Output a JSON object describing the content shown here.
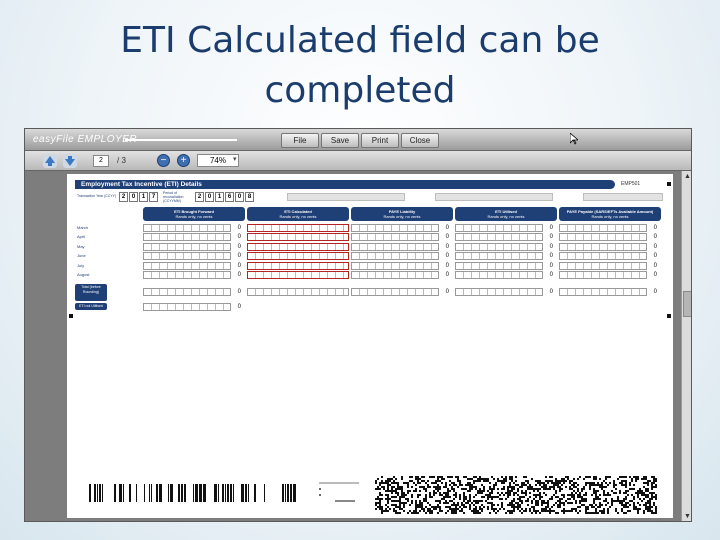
{
  "slide": {
    "title_line1": "ETI Calculated field can be",
    "title_line2": "completed"
  },
  "app": {
    "title": "easyFile EMPLOYER",
    "colors": {
      "accent": "#1f3f77",
      "highlight": "#b52222"
    }
  },
  "menu": [
    {
      "id": "file",
      "label": "File"
    },
    {
      "id": "save",
      "label": "Save"
    },
    {
      "id": "print",
      "label": "Print"
    },
    {
      "id": "close",
      "label": "Close"
    }
  ],
  "toolbar": {
    "page_current": "2",
    "page_sep": "/ 3",
    "zoom_level": "74%",
    "icons": [
      "arrow-up-icon",
      "arrow-down-icon",
      "zoom-out-icon",
      "zoom-in-icon"
    ]
  },
  "form": {
    "title": "Employment Tax Incentive (ETI) Details",
    "code": "EMP501",
    "transaction_year_label": "Transaction Year (CCYY)",
    "transaction_year_digits": [
      "2",
      "0",
      "1",
      "7"
    ],
    "reconciliation_label": "Period of reconciliation (CCYYMM)",
    "reconciliation_digits": [
      "2",
      "0",
      "1",
      "6",
      "0",
      "8"
    ],
    "columns": [
      {
        "title": "ETI Brought Forward",
        "sub": "Rands only, no cents"
      },
      {
        "title": "ETI Calculated",
        "sub": "Rands only, no cents"
      },
      {
        "title": "PAYE Liability",
        "sub": "Rands only, no cents"
      },
      {
        "title": "ETI Utilised",
        "sub": "Rands only, no cents"
      },
      {
        "title": "PAYE Payable (SARS/EFTs Available Amount)",
        "sub": "Rands only, no cents"
      }
    ],
    "rows": [
      {
        "label": "March",
        "values": [
          "0",
          "",
          "0",
          "0",
          "0"
        ]
      },
      {
        "label": "April",
        "values": [
          "0",
          "",
          "0",
          "0",
          "0"
        ]
      },
      {
        "label": "May",
        "values": [
          "0",
          "",
          "0",
          "0",
          "0"
        ]
      },
      {
        "label": "June",
        "values": [
          "0",
          "",
          "0",
          "0",
          "0"
        ]
      },
      {
        "label": "July",
        "values": [
          "0",
          "",
          "0",
          "0",
          "0"
        ]
      },
      {
        "label": "August",
        "values": [
          "0",
          "",
          "0",
          "0",
          "0"
        ]
      }
    ],
    "total": {
      "label": "Total (before Rounding)",
      "values": [
        "0",
        "",
        "0",
        "0",
        "0"
      ]
    },
    "utilised": {
      "label": "ETI not Utilised",
      "value": "0"
    }
  }
}
